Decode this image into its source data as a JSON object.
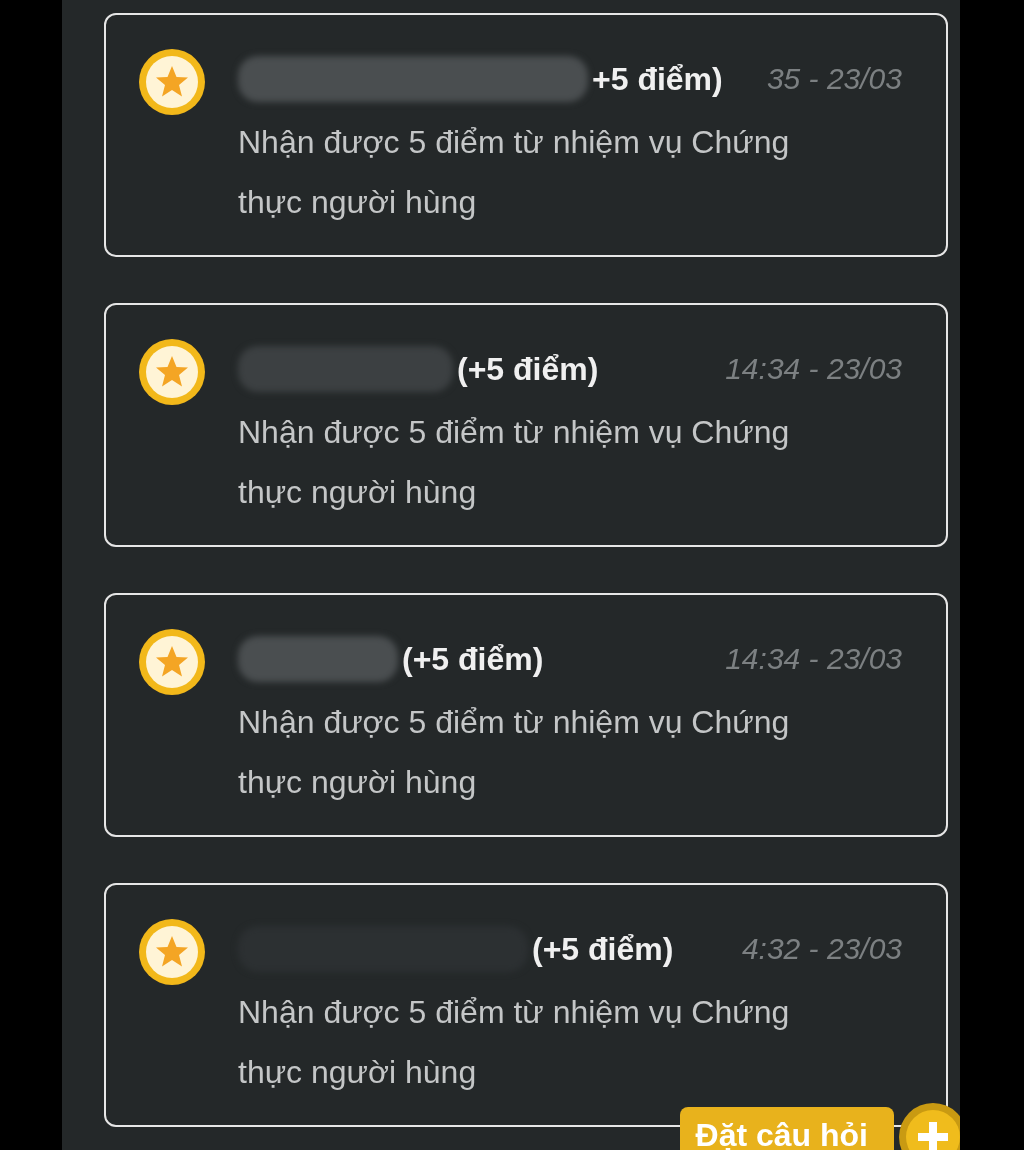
{
  "notifications": [
    {
      "title": "+5 điểm)",
      "time": "35 - 23/03",
      "message": "Nhận được 5 điểm từ nhiệm vụ Chứng thực người hùng"
    },
    {
      "title": "(+5 điểm)",
      "time": "14:34 - 23/03",
      "message": "Nhận được 5 điểm từ nhiệm vụ Chứng thực người hùng"
    },
    {
      "title": "(+5 điểm)",
      "time": "14:34 - 23/03",
      "message": "Nhận được 5 điểm từ nhiệm vụ Chứng thực người hùng"
    },
    {
      "title": "(+5 điểm)",
      "time": "4:32 - 23/03",
      "message": "Nhận được 5 điểm từ nhiệm vụ Chứng thực người hùng"
    }
  ],
  "ask_button": {
    "label": "Đặt câu hỏi"
  }
}
